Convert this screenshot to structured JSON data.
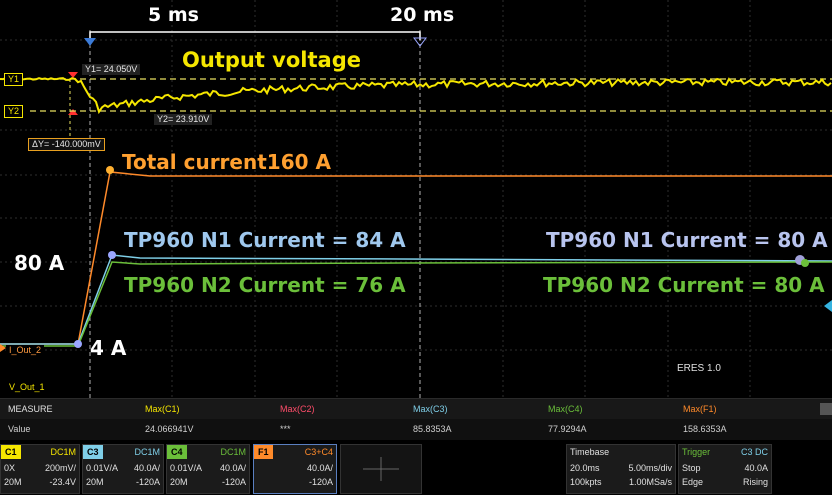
{
  "colors": {
    "ch1": "#f5e600",
    "ch2": "#ff4d6a",
    "ch3": "#7fcfe8",
    "ch4": "#6bbf3a",
    "f1": "#ff8a2a",
    "marker": "#9aa6ff"
  },
  "annotations": {
    "t1": "5 ms",
    "t2": "20 ms",
    "output_voltage": "Output voltage",
    "total_current": "Total current160 A",
    "n1_left": "TP960 N1 Current = 84 A",
    "n2_left": "TP960 N2 Current = 76 A",
    "n1_right": "TP960 N1 Current = 80 A",
    "n2_right": "TP960 N2 Current = 80 A",
    "label_80a": "80 A",
    "label_4a": "4 A"
  },
  "cursors": {
    "y1": "Y1= 24.050V",
    "y2": "Y2= 23.910V",
    "dy": "ΔY= -140.000mV",
    "y1_tag": "Y1",
    "y2_tag": "Y2"
  },
  "trace_labels": {
    "i_out": "I_Out_2",
    "v_out": "V_Out_1"
  },
  "eres": "ERES 1.0",
  "measure": {
    "title": "MEASURE",
    "row_label": "Value",
    "columns": [
      {
        "name": "Max(C1)",
        "value": "24.066941V"
      },
      {
        "name": "Max(C2)",
        "value": "***"
      },
      {
        "name": "Max(C3)",
        "value": "85.8353A"
      },
      {
        "name": "Max(C4)",
        "value": "77.9294A"
      },
      {
        "name": "Max(F1)",
        "value": "158.6353A"
      }
    ]
  },
  "channels": {
    "c1": {
      "tag": "C1",
      "coupling": "DC1M",
      "r1a": "0X",
      "r1b": "200mV/",
      "r2a": "20M",
      "r2b": "-23.4V"
    },
    "c3": {
      "tag": "C3",
      "coupling": "DC1M",
      "r1a": "0.01V/A",
      "r1b": "40.0A/",
      "r2a": "20M",
      "r2b": "-120A"
    },
    "c4": {
      "tag": "C4",
      "coupling": "DC1M",
      "r1a": "0.01V/A",
      "r1b": "40.0A/",
      "r2a": "20M",
      "r2b": "-120A"
    },
    "f1": {
      "tag": "F1",
      "coupling": "C3+C4",
      "r1b": "40.0A/",
      "r2b": "-120A"
    }
  },
  "timebase": {
    "title": "Timebase",
    "r1a": "20.0ms",
    "r1b": "5.00ms/div",
    "r2a": "100kpts",
    "r2b": "1.00MSa/s"
  },
  "trigger": {
    "title": "Trigger",
    "source": "C3 DC",
    "r1a": "Stop",
    "r1b": "40.0A",
    "r2a": "Edge",
    "r2b": "Rising"
  }
}
